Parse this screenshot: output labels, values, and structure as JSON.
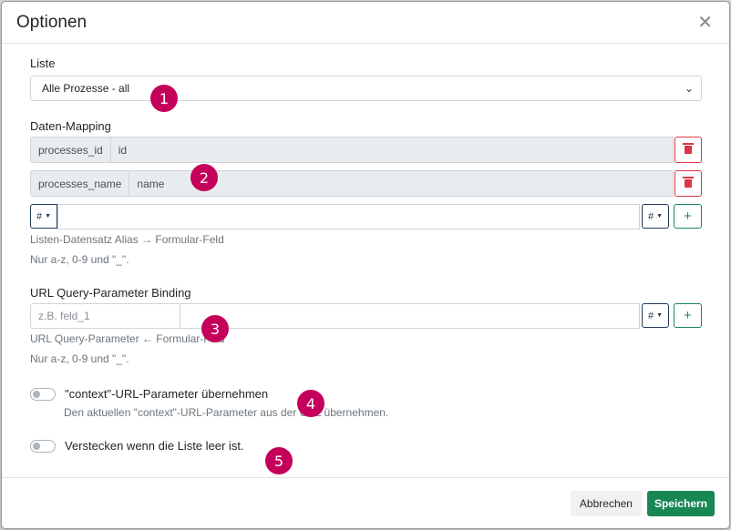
{
  "modal": {
    "title": "Optionen"
  },
  "liste": {
    "label": "Liste",
    "selected": "Alle Prozesse - all"
  },
  "mapping": {
    "label": "Daten-Mapping",
    "rows": [
      {
        "key": "processes_id",
        "value": "id"
      },
      {
        "key": "processes_name",
        "value": "name"
      }
    ],
    "hash_label": "#",
    "add_label": "+",
    "help1": "Listen-Datensatz Alias → Formular-Feld",
    "help2": "Nur a-z, 0-9 und \"_\"."
  },
  "url_binding": {
    "label": "URL Query-Parameter Binding",
    "placeholder": "z.B. feld_1",
    "hash_label": "#",
    "add_label": "+",
    "help1": "URL Query-Parameter ← Formular-Feld",
    "help2": "Nur a-z, 0-9 und \"_\"."
  },
  "context_toggle": {
    "label": "\"context\"-URL-Parameter übernehmen",
    "help": "Den aktuellen \"context\"-URL-Parameter aus der URL übernehmen."
  },
  "hide_toggle": {
    "label": "Verstecken wenn die Liste leer ist."
  },
  "markers": [
    "1",
    "2",
    "3",
    "4",
    "5"
  ],
  "footer": {
    "cancel": "Abbrechen",
    "save": "Speichern"
  },
  "colors": {
    "marker": "#c4005b",
    "save": "#198754",
    "danger": "#dc3545",
    "hash": "#1f3a5a"
  }
}
